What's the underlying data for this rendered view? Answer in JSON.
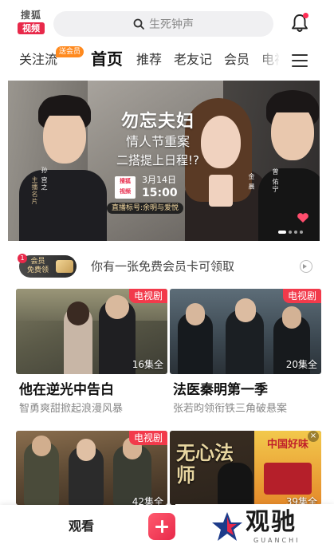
{
  "header": {
    "logo_top": "搜狐",
    "logo_bottom": "视频",
    "search_placeholder": "生死钟声"
  },
  "tabs": {
    "badge": "送会员",
    "items": [
      "关注流",
      "首页",
      "推荐",
      "老友记",
      "会员",
      "电视"
    ]
  },
  "banner": {
    "title_line1": "勿忘夫妇",
    "title_line2": "情人节重案",
    "title_line3": "二搭提上日程!?",
    "date_line1": "3月14日",
    "date_line2": "15:00",
    "logo_text_1": "搜狐",
    "logo_text_2": "视频",
    "live_tag": "直播标号:余明与爱悦",
    "name_left": "孙 宫之",
    "name_left_sub": "主播名片",
    "name_mid": "金 晨",
    "name_right": "曾 佑宁"
  },
  "vip": {
    "badge_count": "1",
    "badge_line1": "会员",
    "badge_line2": "免费领",
    "text": "你有一张免费会员卡可领取"
  },
  "cards": [
    {
      "tag": "电视剧",
      "episodes": "16集全",
      "title": "他在逆光中告白",
      "subtitle": "智勇爽甜掀起浪漫风暴"
    },
    {
      "tag": "电视剧",
      "episodes": "20集全",
      "title": "法医秦明第一季",
      "subtitle": "张若昀领衔铁三角破悬案"
    },
    {
      "tag": "电视剧",
      "episodes": "42集全",
      "title": "",
      "subtitle": ""
    },
    {
      "tag": "",
      "episodes": "39集全",
      "title": "",
      "subtitle": ""
    }
  ],
  "row2_art": {
    "poster_text": "无心法师",
    "ad_text": "中国好味"
  },
  "bottom_nav": {
    "watch": "观看"
  },
  "watermark": {
    "cn": "观驰",
    "en": "GUANCHI"
  },
  "colors": {
    "accent": "#e8294a",
    "tag": "#f23a4b",
    "badge_orange": "#ff8a1f"
  }
}
